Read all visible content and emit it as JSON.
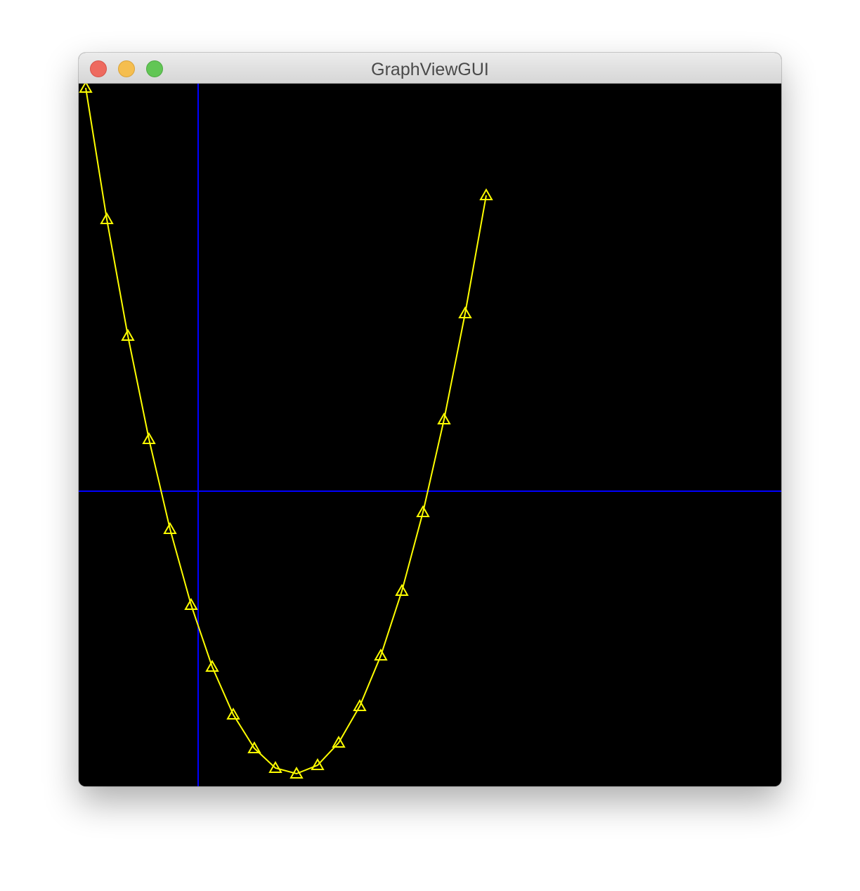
{
  "window": {
    "title": "GraphViewGUI",
    "buttons": [
      "close",
      "minimize",
      "zoom"
    ]
  },
  "colors": {
    "background": "#000000",
    "axes": "#0000ff",
    "series": "#ffff00",
    "close": "#ee6a5f",
    "minimize": "#f5be4f",
    "zoom": "#62c655"
  },
  "chart_data": {
    "type": "line",
    "marker": "triangle",
    "grid": false,
    "xlim": [
      -1.7,
      8.3
    ],
    "ylim": [
      -4.2,
      5.8
    ],
    "x": [
      -1.6,
      -1.3,
      -1.0,
      -0.7,
      -0.4,
      -0.1,
      0.2,
      0.5,
      0.8,
      1.1,
      1.4,
      1.7,
      2.0,
      2.3,
      2.6,
      2.9,
      3.2,
      3.5,
      3.8,
      4.1
    ],
    "y": [
      5.74,
      3.87,
      2.21,
      0.74,
      -0.54,
      -1.62,
      -2.5,
      -3.18,
      -3.66,
      -3.94,
      -4.02,
      -3.9,
      -3.58,
      -3.06,
      -2.34,
      -1.42,
      -0.3,
      1.02,
      2.53,
      4.21
    ]
  }
}
